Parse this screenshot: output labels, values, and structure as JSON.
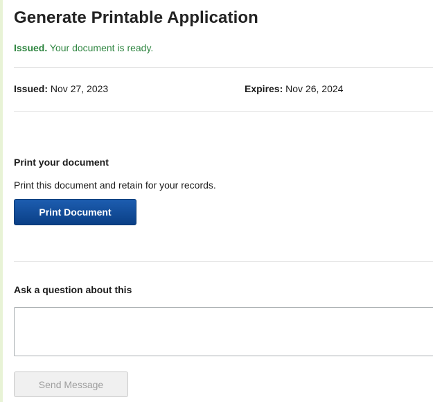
{
  "header": {
    "title": "Generate Printable Application",
    "status_strong": "Issued.",
    "status_text": "Your document is ready."
  },
  "dates": {
    "issued_label": "Issued:",
    "issued_value": "Nov 27, 2023",
    "expires_label": "Expires:",
    "expires_value": "Nov 26, 2024"
  },
  "print_section": {
    "heading": "Print your document",
    "description": "Print this document and retain for your records.",
    "button_label": "Print Document"
  },
  "question_section": {
    "heading": "Ask a question about this",
    "input_value": "",
    "send_label": "Send Message"
  },
  "colors": {
    "background": "#e8f3d6",
    "status_green": "#2e8540",
    "primary_blue": "#0a3f86"
  }
}
